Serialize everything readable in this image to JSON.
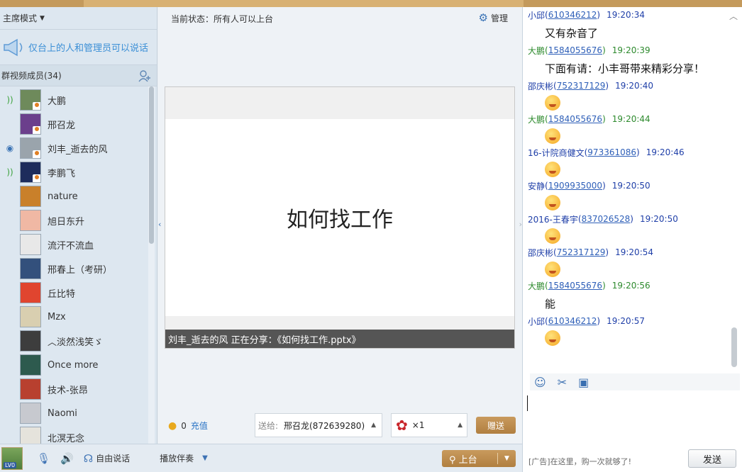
{
  "left": {
    "mode_label": "主席模式",
    "notice": "仅台上的人和管理员可以说话",
    "members_header": "群视频成员(34)",
    "members": [
      {
        "name": "大鹏",
        "status": "speaking",
        "color": "#6e8a5b"
      },
      {
        "name": "邢召龙",
        "status": "",
        "color": "#6b3f8c"
      },
      {
        "name": "刘丰_逝去的风",
        "status": "camera",
        "color": "#9aa4ac"
      },
      {
        "name": "李鹏飞",
        "status": "speaking",
        "color": "#1d2c5c"
      },
      {
        "name": "nature",
        "status": "",
        "color": "#c9802a"
      },
      {
        "name": "旭日东升",
        "status": "",
        "color": "#f0b8a4"
      },
      {
        "name": "流汗不流血",
        "status": "",
        "color": "#e8e8e8"
      },
      {
        "name": "邢春上（考研）",
        "status": "",
        "color": "#33507c"
      },
      {
        "name": "丘比特",
        "status": "",
        "color": "#e0452f"
      },
      {
        "name": "Mzx",
        "status": "",
        "color": "#d9cfb0"
      },
      {
        "name": "︿淡然浅笑ゞ",
        "status": "",
        "color": "#3d3d3d"
      },
      {
        "name": "Once more",
        "status": "",
        "color": "#2d5a4e"
      },
      {
        "name": "技术-张昂",
        "status": "",
        "color": "#b8402f"
      },
      {
        "name": "Naomi",
        "status": "",
        "color": "#c7c9cf"
      },
      {
        "name": "北溟无念",
        "status": "",
        "color": "#e5e3dc"
      }
    ]
  },
  "middle": {
    "status_text": "当前状态：所有人可以上台",
    "manage_label": "管理",
    "slide_title": "如何找工作",
    "share_text": "刘丰_逝去的风 正在分享：《如何找工作.pptx》",
    "coin_count": "0",
    "recharge_label": "充值",
    "send_to_label": "送给:",
    "send_to_value": "邢召龙(872639280)",
    "gift_count": "×1",
    "give_label": "赠送"
  },
  "bottom": {
    "lv_label": "LV0",
    "free_talk_label": "自由说话",
    "accompaniment_label": "播放伴奏",
    "stage_label": "上台"
  },
  "chat": {
    "messages": [
      {
        "sender": "小邱",
        "uid": "610346212",
        "time": "19:20:34",
        "green": false,
        "text": "又有杂音了",
        "emoji": false
      },
      {
        "sender": "大鹏",
        "uid": "1584055676",
        "time": "19:20:39",
        "green": true,
        "text": "下面有请：小丰哥带来精彩分享！",
        "emoji": false
      },
      {
        "sender": "邵庆彬",
        "uid": "752317129",
        "time": "19:20:40",
        "green": false,
        "text": "",
        "emoji": true
      },
      {
        "sender": "大鹏",
        "uid": "1584055676",
        "time": "19:20:44",
        "green": true,
        "text": "",
        "emoji": true
      },
      {
        "sender": "16-计院商健文",
        "uid": "973361086",
        "time": "19:20:46",
        "green": false,
        "text": "",
        "emoji": true
      },
      {
        "sender": "安静",
        "uid": "1909935000",
        "time": "19:20:50",
        "green": false,
        "text": "",
        "emoji": true
      },
      {
        "sender": "2016-王春宇",
        "uid": "837026528",
        "time": "19:20:50",
        "green": false,
        "text": "",
        "emoji": true
      },
      {
        "sender": "邵庆彬",
        "uid": "752317129",
        "time": "19:20:54",
        "green": false,
        "text": "",
        "emoji": true
      },
      {
        "sender": "大鹏",
        "uid": "1584055676",
        "time": "19:20:56",
        "green": true,
        "text": "能",
        "emoji": false
      },
      {
        "sender": "小邱",
        "uid": "610346212",
        "time": "19:20:57",
        "green": false,
        "text": "",
        "emoji": true
      }
    ],
    "ad_text": "[广告]在这里，购一次就够了!",
    "send_label": "发送"
  },
  "colors": {
    "accent_gold": "#c49a5c",
    "link_blue": "#2e5fb8",
    "green_sender": "#2d8a2d"
  }
}
